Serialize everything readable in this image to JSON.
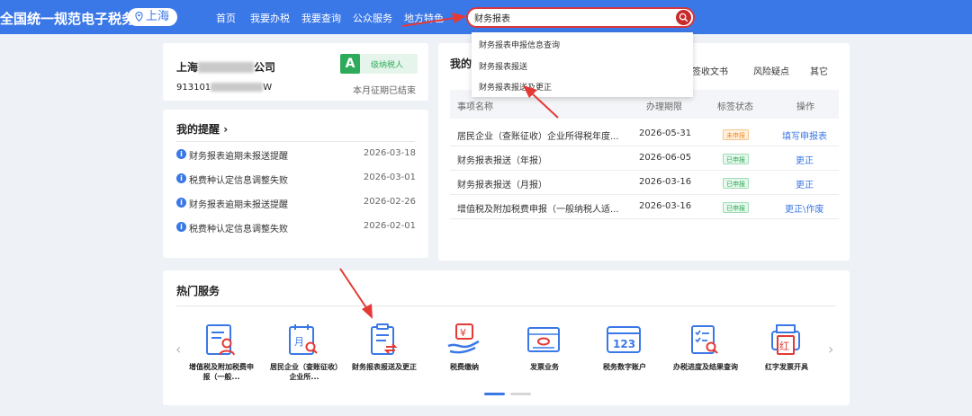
{
  "header": {
    "brand": "全国统一规范电子税务局",
    "city": "上海",
    "nav": [
      "首页",
      "我要办税",
      "我要查询",
      "公众服务",
      "地方特色"
    ]
  },
  "search": {
    "value": "财务报表",
    "suggestions": [
      "财务报表申报信息查询",
      "财务报表报送",
      "财务报表报送及更正"
    ]
  },
  "company": {
    "name_prefix": "上海",
    "name_suffix": "公司",
    "grade": "A",
    "taxpayer_type": "级纳税人",
    "tax_id_prefix": "913101",
    "tax_id_suffix": "W",
    "period_status": "本月征期已结束"
  },
  "reminders": {
    "title": "我的提醒",
    "arrow": "›",
    "items": [
      {
        "text": "财务报表逾期未报送提醒",
        "date": "2026-03-18"
      },
      {
        "text": "税费种认定信息调整失败",
        "date": "2026-03-01"
      },
      {
        "text": "财务报表逾期未报送提醒",
        "date": "2026-02-26"
      },
      {
        "text": "税费种认定信息调整失败",
        "date": "2026-02-01"
      }
    ]
  },
  "todo": {
    "title": "我的",
    "tabs": [
      "待签收文书",
      "风险疑点",
      "其它"
    ],
    "columns": [
      "事项名称",
      "办理期限",
      "标签状态",
      "操作"
    ],
    "rows": [
      {
        "name": "居民企业（查账征收）企业所得税年度...",
        "deadline": "2026-05-31",
        "status": "未申报",
        "status_type": "pending",
        "action": "填写申报表"
      },
      {
        "name": "财务报表报送（年报）",
        "deadline": "2026-06-05",
        "status": "已申报",
        "status_type": "done",
        "action": "更正"
      },
      {
        "name": "财务报表报送（月报）",
        "deadline": "2026-03-16",
        "status": "已申报",
        "status_type": "done",
        "action": "更正"
      },
      {
        "name": "增值税及附加税费申报（一般纳税人适...",
        "deadline": "2026-03-16",
        "status": "已申报",
        "status_type": "done",
        "action": "更正\\作废"
      }
    ]
  },
  "hot_services": {
    "title": "热门服务",
    "prev": "‹",
    "next": "›",
    "items": [
      {
        "label": "增值税及附加税费申报（一般...",
        "icon": "vat-declaration-icon"
      },
      {
        "label": "居民企业（查账征收）企业所...",
        "icon": "calendar-month-search-icon",
        "glyph": "月"
      },
      {
        "label": "财务报表报送及更正",
        "icon": "clipboard-exchange-icon"
      },
      {
        "label": "税费缴纳",
        "icon": "hand-coin-icon",
        "glyph": "¥"
      },
      {
        "label": "发票业务",
        "icon": "invoice-icon"
      },
      {
        "label": "税务数字账户",
        "icon": "digital-account-icon",
        "glyph": "123"
      },
      {
        "label": "办税进度及结果查询",
        "icon": "progress-search-icon"
      },
      {
        "label": "红字发票开具",
        "icon": "red-invoice-icon",
        "glyph": "红"
      }
    ]
  },
  "colors": {
    "primary": "#3b78e7",
    "alert_red": "#e53935",
    "grade_green": "#2eab5a",
    "pending_orange": "#f08c2c"
  }
}
